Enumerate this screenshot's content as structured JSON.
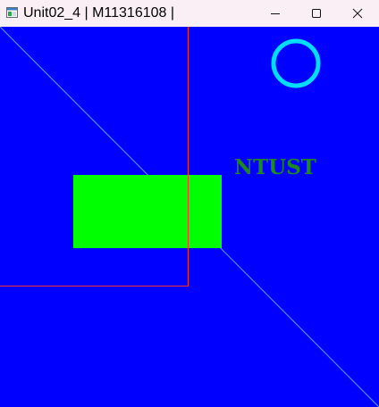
{
  "window": {
    "title": "Unit02_4 | M11316108 |",
    "controls": [
      "minimize",
      "maximize",
      "close"
    ]
  },
  "canvas": {
    "background_color": "#0000ff",
    "shapes": [
      {
        "kind": "line",
        "color": "#55aaff",
        "description": "diagonal line"
      },
      {
        "kind": "rectangle-outline",
        "color": "#ff3030"
      },
      {
        "kind": "filled-rectangle",
        "color": "#00ff00"
      },
      {
        "kind": "circle-outline",
        "color": "#00ddff"
      }
    ],
    "text": {
      "label": "NTUST",
      "color": "#1e8a1e"
    }
  }
}
